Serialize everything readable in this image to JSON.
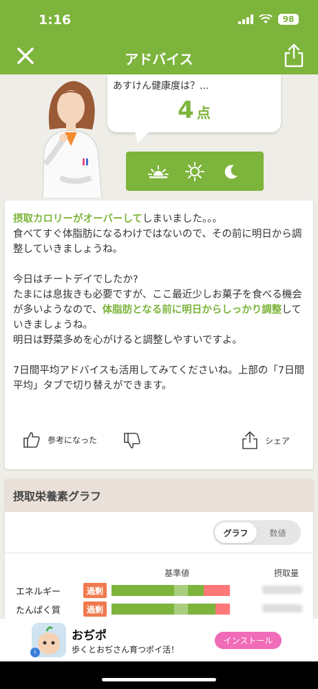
{
  "status": {
    "time": "1:16",
    "battery": "98"
  },
  "nav": {
    "title": "アドバイス",
    "close_icon": "close-icon",
    "share_icon": "share-icon"
  },
  "hero": {
    "question": "あすけん健康度は？...",
    "score": "4",
    "score_unit": "点",
    "time_tabs": [
      "sunrise-icon",
      "sun-icon",
      "moon-icon"
    ]
  },
  "advice": {
    "p1_highlight": "摂取カロリーがオーバーして",
    "p1_rest": "しまいました。。。",
    "p1_line2": "食べてすぐ体脂肪になるわけではないので、その前に明日から調整していきましょうね。",
    "p2_line1": "今日はチートデイでしたか?",
    "p2_line2a": "たまには息抜きも必要ですが、ここ最近少しお菓子を食べる機会が多いようなので、",
    "p2_highlight": "体脂肪となる前に明日からしっかり調整",
    "p2_line2b": "していきましょうね。",
    "p2_line3": "明日は野菜多めを心がけると調整しやすいですよ。",
    "p3": "7日間平均アドバイスも活用してみてくださいね。上部の「7日間平均」タブで切り替えができます。",
    "helpful_label": "参考になった",
    "share_label": "シェア"
  },
  "nutrition": {
    "title": "摂取栄養素グラフ",
    "toggle": {
      "graph": "グラフ",
      "value": "数値",
      "active": "graph"
    },
    "col_base": "基準値",
    "col_intake": "摂取量",
    "rows": [
      {
        "label": "エネルギー",
        "badge": "過剰",
        "green_ratio": 0.78,
        "red_ratio": 0.22
      },
      {
        "label": "たんぱく質",
        "badge": "過剰",
        "green_ratio": 0.88,
        "red_ratio": 0.12
      }
    ]
  },
  "ad": {
    "title": "おぢポ",
    "subtitle": "歩くとおぢさん育つポイ活！",
    "install": "インストール",
    "info": "i"
  },
  "colors": {
    "accent": "#7db43c",
    "over": "#f07a4f",
    "red_bar": "#ff7777",
    "install": "#f06bb8"
  }
}
